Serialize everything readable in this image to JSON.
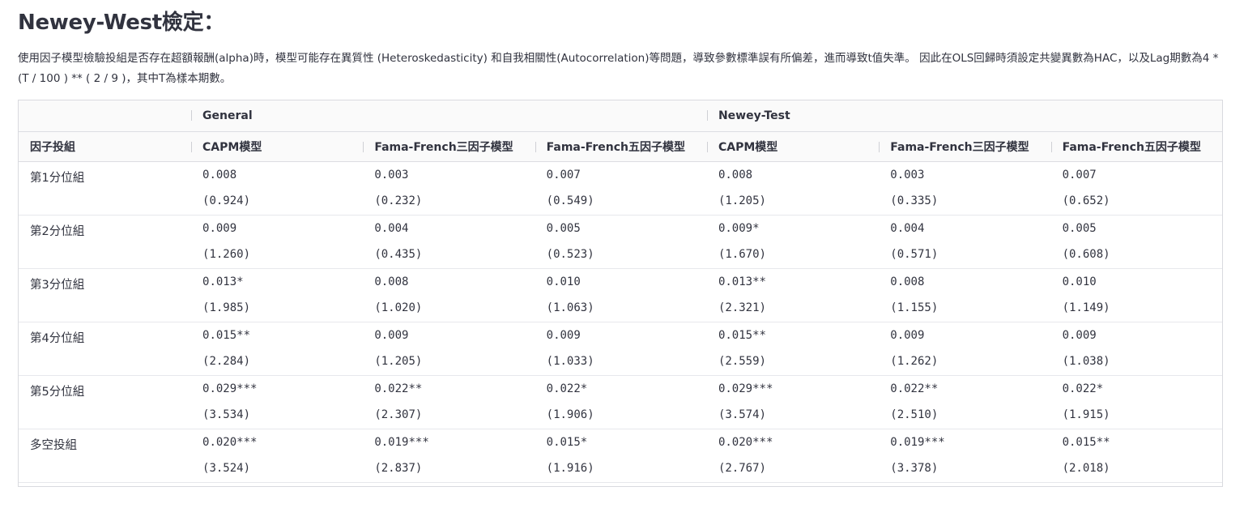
{
  "title": "Newey-West檢定：",
  "description": "使用因子模型檢驗投組是否存在超額報酬(alpha)時，模型可能存在異質性 (Heteroskedasticity) 和自我相關性(Autocorrelation)等問題，導致參數標準誤有所偏差，進而導致t值失準。 因此在OLS回歸時須設定共變異數為HAC，以及Lag期數為4 * (T / 100 ) ** ( 2 / 9 )，其中T為樣本期數。",
  "table": {
    "groups": [
      "General",
      "Newey-Test"
    ],
    "row_header_label": "因子投組",
    "columns": [
      "CAPM模型",
      "Fama-French三因子模型",
      "Fama-French五因子模型",
      "CAPM模型",
      "Fama-French三因子模型",
      "Fama-French五因子模型"
    ],
    "rows": [
      {
        "label": "第1分位組",
        "coef": [
          "0.008",
          "0.003",
          "0.007",
          "0.008",
          "0.003",
          "0.007"
        ],
        "tstat": [
          "(0.924)",
          "(0.232)",
          "(0.549)",
          "(1.205)",
          "(0.335)",
          "(0.652)"
        ]
      },
      {
        "label": "第2分位組",
        "coef": [
          "0.009",
          "0.004",
          "0.005",
          "0.009*",
          "0.004",
          "0.005"
        ],
        "tstat": [
          "(1.260)",
          "(0.435)",
          "(0.523)",
          "(1.670)",
          "(0.571)",
          "(0.608)"
        ]
      },
      {
        "label": "第3分位組",
        "coef": [
          "0.013*",
          "0.008",
          "0.010",
          "0.013**",
          "0.008",
          "0.010"
        ],
        "tstat": [
          "(1.985)",
          "(1.020)",
          "(1.063)",
          "(2.321)",
          "(1.155)",
          "(1.149)"
        ]
      },
      {
        "label": "第4分位組",
        "coef": [
          "0.015**",
          "0.009",
          "0.009",
          "0.015**",
          "0.009",
          "0.009"
        ],
        "tstat": [
          "(2.284)",
          "(1.205)",
          "(1.033)",
          "(2.559)",
          "(1.262)",
          "(1.038)"
        ]
      },
      {
        "label": "第5分位組",
        "coef": [
          "0.029***",
          "0.022**",
          "0.022*",
          "0.029***",
          "0.022**",
          "0.022*"
        ],
        "tstat": [
          "(3.534)",
          "(2.307)",
          "(1.906)",
          "(3.574)",
          "(2.510)",
          "(1.915)"
        ]
      },
      {
        "label": "多空投組",
        "coef": [
          "0.020***",
          "0.019***",
          "0.015*",
          "0.020***",
          "0.019***",
          "0.015**"
        ],
        "tstat": [
          "(3.524)",
          "(2.837)",
          "(1.916)",
          "(2.767)",
          "(3.378)",
          "(2.018)"
        ]
      }
    ]
  }
}
